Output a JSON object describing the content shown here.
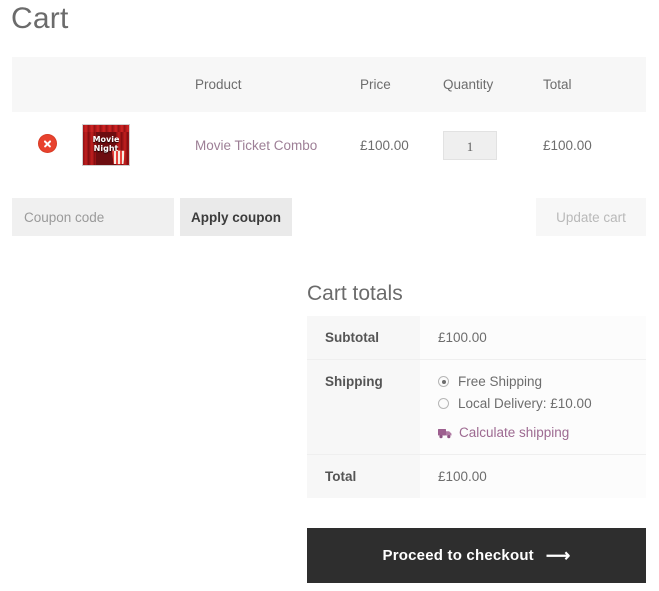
{
  "page": {
    "title": "Cart"
  },
  "cart_table": {
    "headers": {
      "remove": "",
      "thumbnail": "",
      "product": "Product",
      "price": "Price",
      "quantity": "Quantity",
      "total": "Total"
    },
    "rows": [
      {
        "remove_icon": "remove-circle-icon",
        "thumbnail_alt": "Movie Night",
        "thumbnail_line1": "Movie",
        "thumbnail_line2": "Night",
        "product_name": "Movie Ticket Combo",
        "price": "£100.00",
        "quantity": "1",
        "total": "£100.00"
      }
    ]
  },
  "coupon": {
    "placeholder": "Coupon code",
    "value": "",
    "apply_label": "Apply coupon",
    "update_label": "Update cart",
    "update_disabled": true
  },
  "totals": {
    "heading": "Cart totals",
    "subtotal_label": "Subtotal",
    "subtotal_value": "£100.00",
    "shipping_label": "Shipping",
    "shipping_options": [
      {
        "label": "Free Shipping",
        "selected": true
      },
      {
        "label": "Local Delivery: £10.00",
        "selected": false
      }
    ],
    "calculate_shipping_label": "Calculate shipping",
    "calculate_shipping_icon": "delivery-truck-icon",
    "total_label": "Total",
    "total_value": "£100.00"
  },
  "checkout": {
    "label": "Proceed to checkout",
    "arrow": "⟶"
  },
  "colors": {
    "accent_link": "#9d7f96",
    "shipping_link": "#9d6a91",
    "remove_button": "#e8422e",
    "checkout_bg": "#2e2e2e",
    "header_bg": "#f7f7f7",
    "text_muted": "#6d6d6d"
  }
}
